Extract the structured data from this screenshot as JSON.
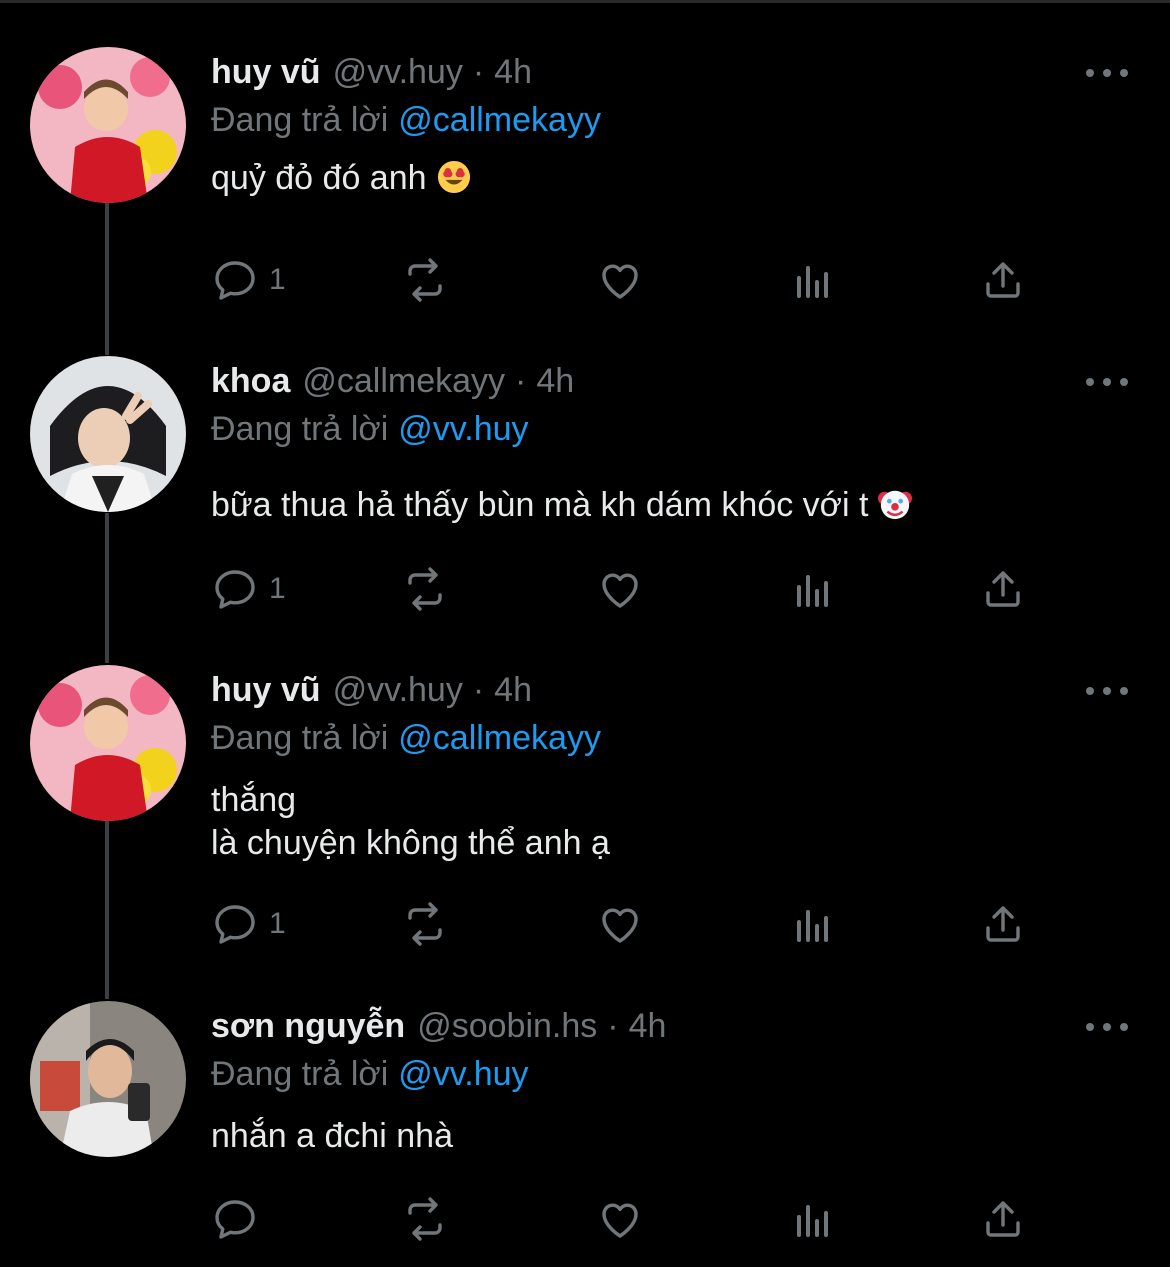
{
  "tweets": [
    {
      "name": "huy vũ",
      "handle": "@vv.huy",
      "separator": "·",
      "time": "4h",
      "reply_prefix": "Đang trả lời",
      "reply_to": "@callmekayy",
      "text": "quỷ đỏ đó anh",
      "emoji": "heart-eyes",
      "reply_count": "1"
    },
    {
      "name": "khoa",
      "handle": "@callmekayy",
      "separator": "·",
      "time": "4h",
      "reply_prefix": "Đang trả lời",
      "reply_to": "@vv.huy",
      "text": "bữa thua hả thấy bùn mà kh dám khóc với t",
      "emoji": "clown",
      "reply_count": "1"
    },
    {
      "name": "huy vũ",
      "handle": "@vv.huy",
      "separator": "·",
      "time": "4h",
      "reply_prefix": "Đang trả lời",
      "reply_to": "@callmekayy",
      "text": "thắng\nlà chuyện không thể anh ạ",
      "emoji": "",
      "reply_count": "1"
    },
    {
      "name": "sơn nguyễn",
      "handle": "@soobin.hs",
      "separator": "·",
      "time": "4h",
      "reply_prefix": "Đang trả lời",
      "reply_to": "@vv.huy",
      "text": "nhắn a đchi nhà",
      "emoji": "",
      "reply_count": ""
    }
  ],
  "icons": [
    "more-icon",
    "reply-icon",
    "retweet-icon",
    "like-icon",
    "views-icon",
    "share-icon"
  ],
  "colors": {
    "background": "#000000",
    "text": "#e7e9ea",
    "secondary": "#71767b",
    "mention": "#1d9bf0",
    "thread_line": "#3b3f43"
  }
}
